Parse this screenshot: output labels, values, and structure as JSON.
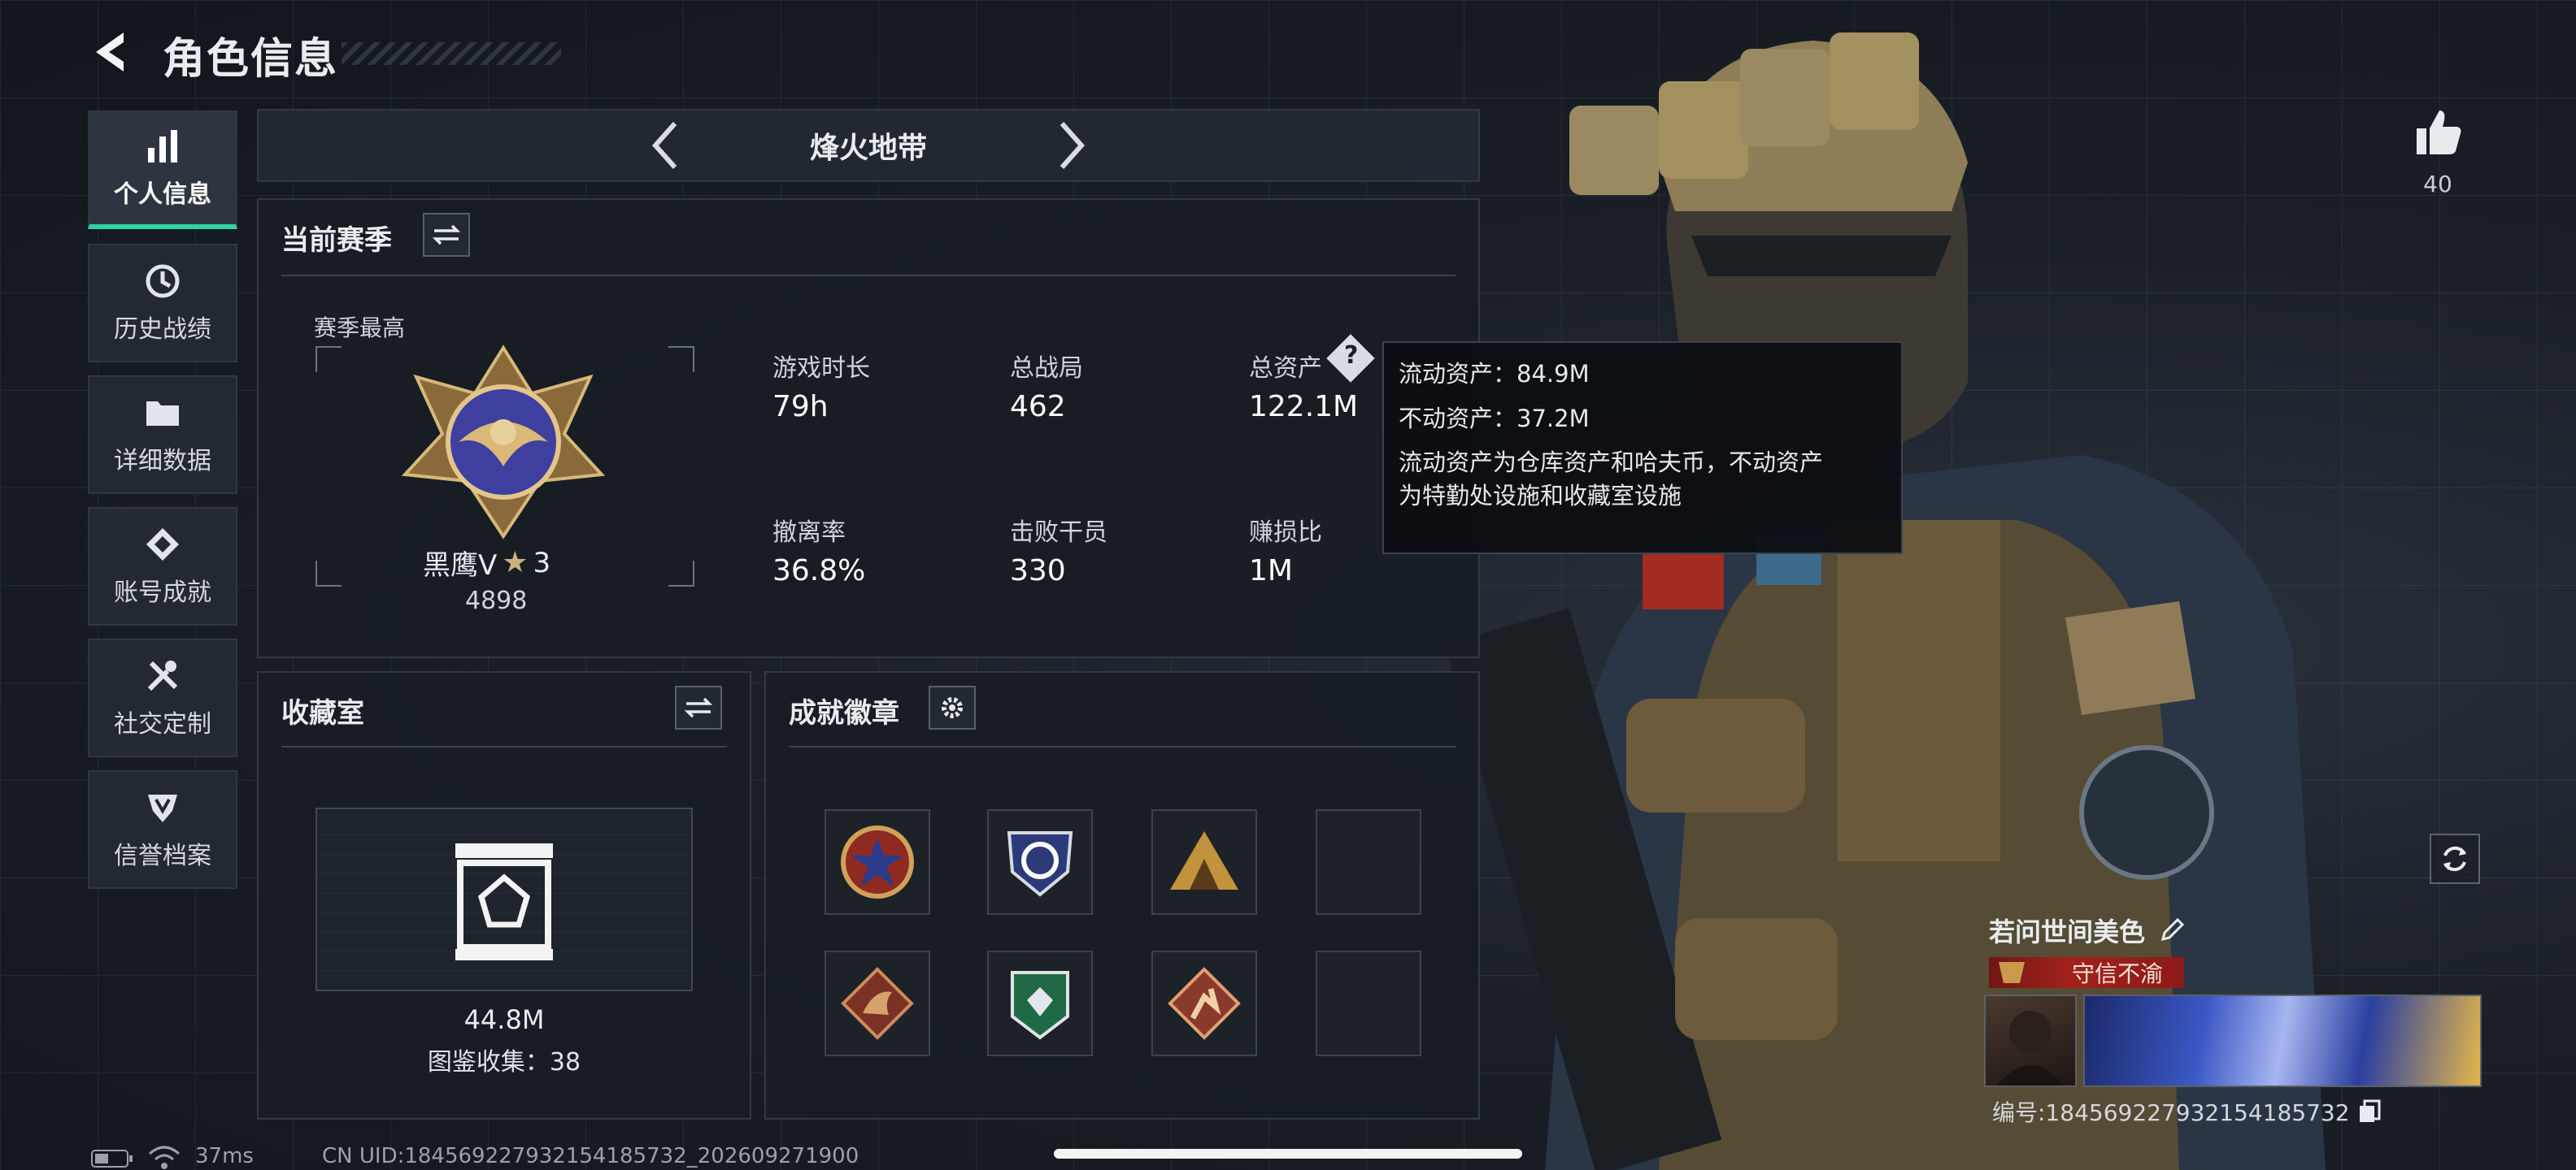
{
  "header": {
    "title": "角色信息"
  },
  "sidebar": {
    "items": [
      {
        "label": "个人信息",
        "icon": "bar-chart-icon",
        "active": true
      },
      {
        "label": "历史战绩",
        "icon": "history-icon",
        "active": false
      },
      {
        "label": "详细数据",
        "icon": "folder-icon",
        "active": false
      },
      {
        "label": "账号成就",
        "icon": "achievement-icon",
        "active": false
      },
      {
        "label": "社交定制",
        "icon": "tools-icon",
        "active": false
      },
      {
        "label": "信誉档案",
        "icon": "reputation-icon",
        "active": false
      }
    ]
  },
  "mode_nav": {
    "title": "烽火地带"
  },
  "season": {
    "section_title": "当前赛季",
    "best_label": "赛季最高",
    "rank_name": "黑鹰Ⅴ",
    "rank_stars": "3",
    "rank_score": "4898",
    "stats": [
      {
        "label": "游戏时长",
        "value": "79h"
      },
      {
        "label": "总战局",
        "value": "462"
      },
      {
        "label": "总资产",
        "value": "122.1M"
      },
      {
        "label": "撤离率",
        "value": "36.8%"
      },
      {
        "label": "击败干员",
        "value": "330"
      },
      {
        "label": "赚损比",
        "value": "1M"
      }
    ]
  },
  "tooltip": {
    "liquid": "流动资产：84.9M",
    "fixed": "不动资产：37.2M",
    "desc_line1": "流动资产为仓库资产和哈夫币，不动资产",
    "desc_line2": "为特勤处设施和收藏室设施"
  },
  "collection": {
    "title": "收藏室",
    "value": "44.8M",
    "catalog": "图鉴收集：38"
  },
  "badges": {
    "title": "成就徽章"
  },
  "player": {
    "likes": "40",
    "name": "若问世间美色",
    "tag": "守信不渝",
    "id": "编号:18456922793215418573​2"
  },
  "status_bar": {
    "ping": "37ms",
    "uid": "CN UID:18456922793215418573​2_202609271900"
  },
  "colors": {
    "accent": "#2ed3a2",
    "tag_red": "#8d1a17"
  }
}
